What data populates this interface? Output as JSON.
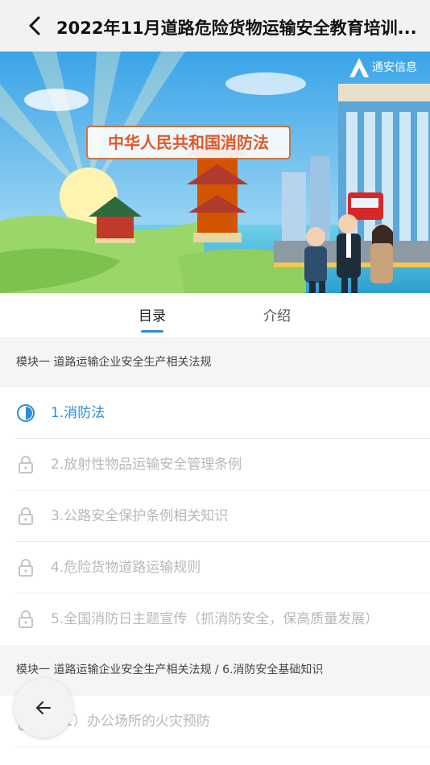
{
  "header": {
    "title": "2022年11月道路危险货物运输安全教育培训..."
  },
  "banner": {
    "headline": "中华人民共和国消防法",
    "brand": "通安信息"
  },
  "tabs": [
    {
      "label": "目录",
      "active": true
    },
    {
      "label": "介绍",
      "active": false
    }
  ],
  "sections": [
    {
      "title": "模块一 道路运输企业安全生产相关法规"
    },
    {
      "title": "模块一 道路运输企业安全生产相关法规 / 6.消防安全基础知识"
    }
  ],
  "items": [
    {
      "label": "1.消防法",
      "state": "in-progress"
    },
    {
      "label": "2.放射性物品运输安全管理条例",
      "state": "locked"
    },
    {
      "label": "3.公路安全保护条例相关知识",
      "state": "locked"
    },
    {
      "label": "4.危险货物道路运输规则",
      "state": "locked"
    },
    {
      "label": "5.全国消防日主题宣传（抓消防安全，保高质量发展）",
      "state": "locked"
    },
    {
      "label": "（1）办公场所的火灾预防",
      "state": "locked"
    }
  ],
  "colors": {
    "accent": "#2d8bd8",
    "locked": "#b8b8b8",
    "header_bg": "#f2f2f2",
    "section_bg": "#f5f5f5"
  },
  "icons": {
    "back": "chevron-left-icon",
    "progress": "half-circle-icon",
    "lock": "lock-icon",
    "fab": "arrow-left-icon"
  }
}
